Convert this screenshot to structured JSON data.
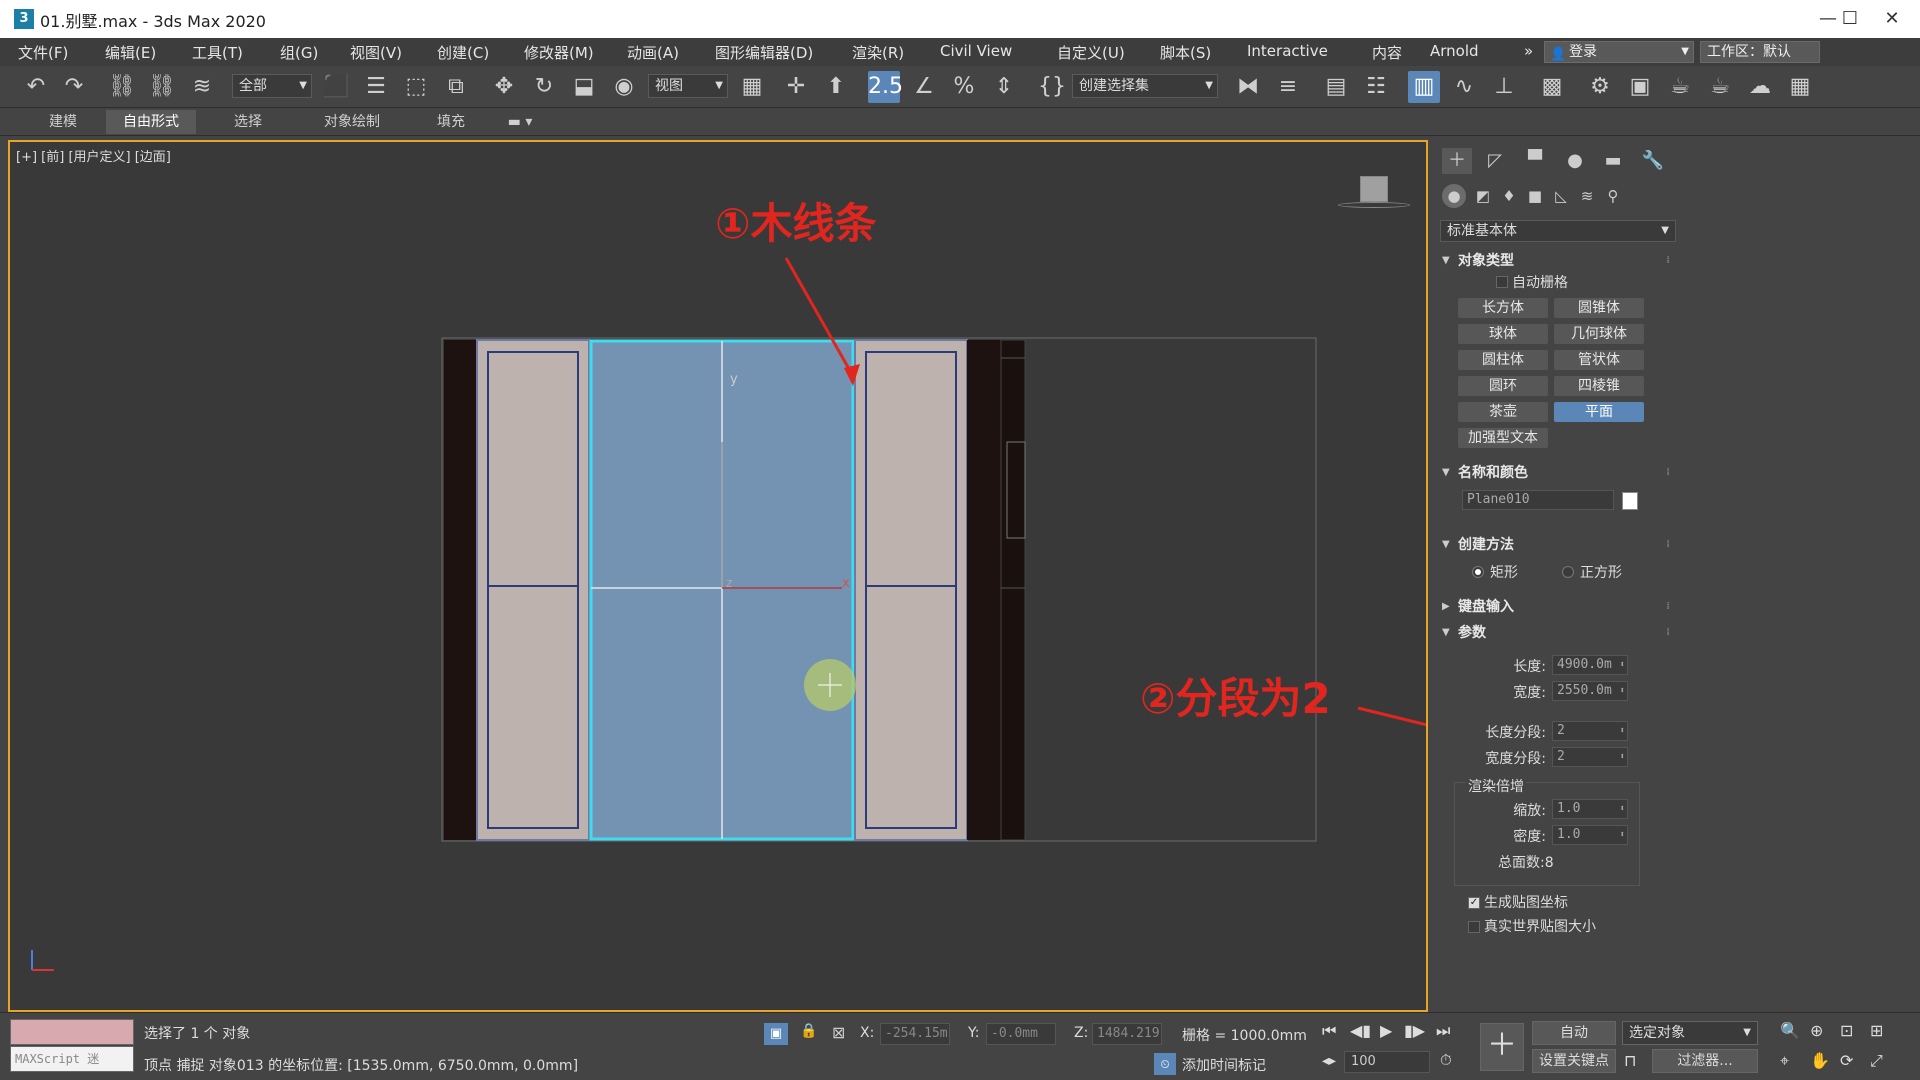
{
  "window": {
    "title": "01.别墅.max - 3ds Max 2020",
    "app_icon": "3",
    "minimize": "—",
    "maximize": "☐",
    "close": "✕"
  },
  "menu": {
    "items": [
      "文件(F)",
      "编辑(E)",
      "工具(T)",
      "组(G)",
      "视图(V)",
      "创建(C)",
      "修改器(M)",
      "动画(A)",
      "图形编辑器(D)",
      "渲染(R)",
      "Civil View",
      "自定义(U)",
      "脚本(S)",
      "Interactive",
      "内容",
      "Arnold"
    ],
    "more": "»",
    "login": "登录",
    "workspace": "工作区：默认"
  },
  "toolbar": {
    "selection_filter": "全部",
    "ref_coord": "视图",
    "named_selection": "创建选择集"
  },
  "ribbon": {
    "tabs": [
      "建模",
      "自由形式",
      "选择",
      "对象绘制",
      "填充"
    ],
    "active_tab": "自由形式"
  },
  "viewport": {
    "label": "[+] [前] [用户定义] [边面]",
    "axis_y": "y",
    "axis_x": "x",
    "axis_z": "z"
  },
  "annotations": {
    "step1": "①木线条",
    "step2": "②分段为2"
  },
  "command_panel": {
    "category": "标准基本体",
    "object_type": {
      "header": "对象类型",
      "autogrid": "自动栅格",
      "buttons": [
        "长方体",
        "圆锥体",
        "球体",
        "几何球体",
        "圆柱体",
        "管状体",
        "圆环",
        "四棱锥",
        "茶壶",
        "平面",
        "加强型文本"
      ],
      "active": "平面"
    },
    "name_color": {
      "header": "名称和颜色",
      "name": "Plane010",
      "color": "#ffffff"
    },
    "creation_method": {
      "header": "创建方法",
      "options": [
        "矩形",
        "正方形"
      ],
      "selected": "矩形"
    },
    "keyboard_entry": {
      "header": "键盘输入"
    },
    "parameters": {
      "header": "参数",
      "length_label": "长度:",
      "length": "4900.0m",
      "width_label": "宽度:",
      "width": "2550.0m",
      "length_segs_label": "长度分段:",
      "length_segs": "2",
      "width_segs_label": "宽度分段:",
      "width_segs": "2",
      "render_multipliers": "渲染倍增",
      "scale_label": "缩放:",
      "scale": "1.0",
      "density_label": "密度:",
      "density": "1.0",
      "total_faces": "总面数:8",
      "gen_mapping": "生成贴图坐标",
      "real_world": "真实世界贴图大小"
    }
  },
  "status": {
    "maxscript": "MAXScript 迷",
    "selected": "选择了 1 个 对象",
    "prompt": "顶点 捕捉 对象013 的坐标位置: [1535.0mm, 6750.0mm, 0.0mm]",
    "x_label": "X:",
    "x": "-254.15m",
    "y_label": "Y:",
    "y": "-0.0mm",
    "z_label": "Z:",
    "z": "1484.219",
    "grid": "栅格 = 1000.0mm",
    "add_time_tag": "添加时间标记",
    "auto_key": "自动",
    "set_key": "设置关键点",
    "key_filter_sel": "选定对象",
    "filters": "过滤器...",
    "frame": "100"
  },
  "colors": {
    "accent": "#5b87b8",
    "viewport_border": "#e4a52a",
    "annotation": "#e0261e",
    "selected_plane": "#7492b2",
    "selection_outline": "#3ddcf0"
  }
}
